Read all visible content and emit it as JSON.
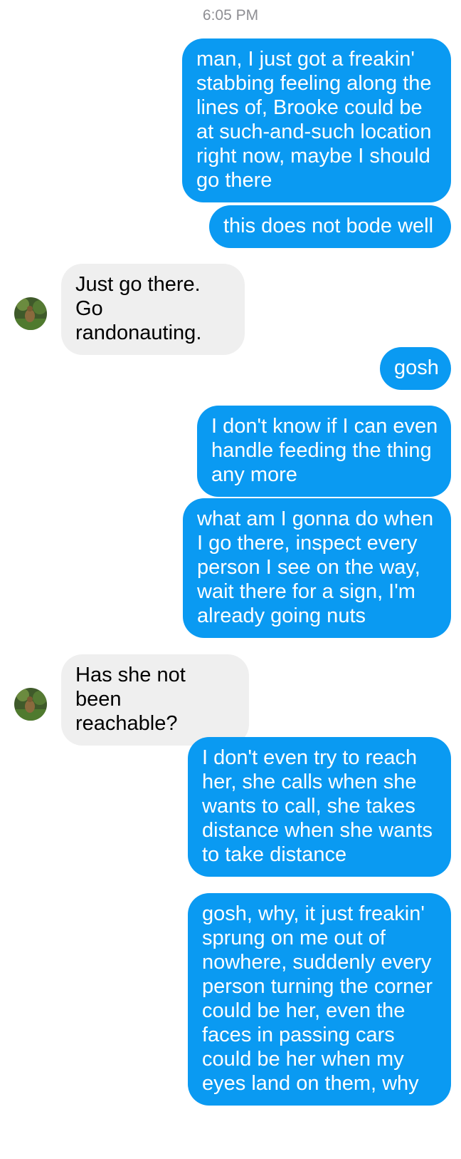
{
  "timestamp": "6:05 PM",
  "messages": [
    {
      "from": "me",
      "text": "man, I just got a freakin'\nstabbing feeling along the\nlines of, Brooke could be\nat such-and-such location\nright now, maybe I should\ngo there"
    },
    {
      "from": "me",
      "text": "this does not bode well"
    },
    {
      "from": "them",
      "text": "Just go there. Go\nrandonauting."
    },
    {
      "from": "me",
      "text": "gosh"
    },
    {
      "from": "me",
      "text": "I don't know if I can even\nhandle feeding the thing\nany more"
    },
    {
      "from": "me",
      "text": "what am I gonna do when\nI go there, inspect every\nperson I see on the way,\nwait there for a sign, I'm\nalready going nuts"
    },
    {
      "from": "them",
      "text": "Has she not been\nreachable?"
    },
    {
      "from": "me",
      "text": "I don't even try to reach\nher, she calls when she\nwants to call, she takes\ndistance when she wants\nto take distance"
    },
    {
      "from": "me",
      "text": "gosh, why, it just freakin'\nsprung on me out of\nnowhere, suddenly every\nperson turning the corner\ncould be her, even the\nfaces in passing cars\ncould be her when my\neyes land on them, why"
    }
  ],
  "colors": {
    "sent_bubble": "#0a9af2",
    "received_bubble": "#efefef",
    "timestamp_text": "#8e8e93"
  },
  "icons": {
    "contact_avatar": "avatar-photo-icon"
  }
}
